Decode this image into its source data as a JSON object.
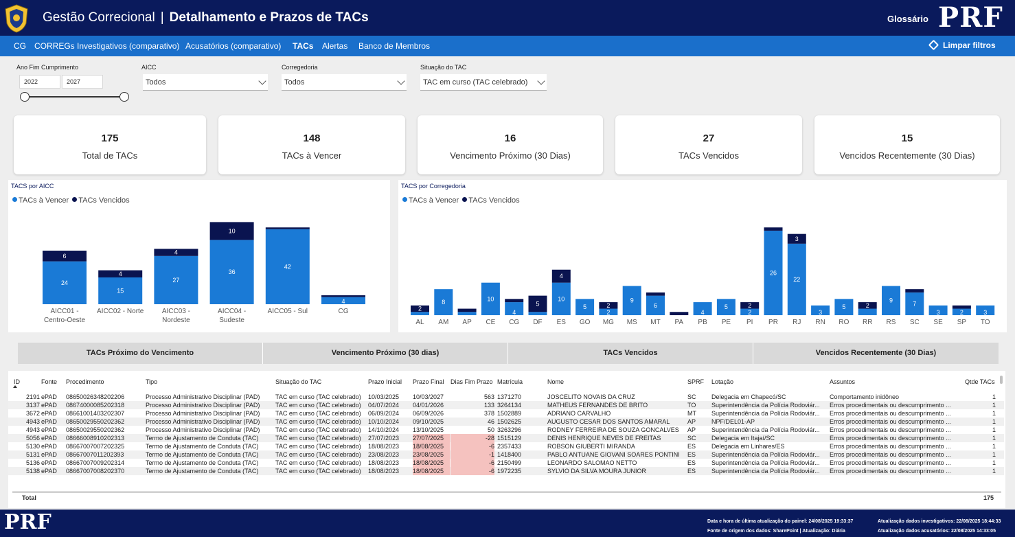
{
  "header": {
    "app_title": "Gestão Correcional",
    "separator": "|",
    "page_title": "Detalhamento e Prazos de TACs",
    "glossary_label": "Glossário",
    "logo_text": "PRF"
  },
  "nav": {
    "items": [
      {
        "label": "CG"
      },
      {
        "label": "CORREGs"
      },
      {
        "label": "Investigativos (comparativo)"
      },
      {
        "label": "Acusatórios (comparativo)"
      },
      {
        "label": "TACs"
      },
      {
        "label": "Alertas"
      },
      {
        "label": "Banco de Membros"
      }
    ],
    "active_item": "TACs",
    "clear_filters": "Limpar filtros"
  },
  "filters": {
    "year": {
      "label": "Ano Fim Cumprimento",
      "from": "2022",
      "to": "2027"
    },
    "aicc": {
      "label": "AICC",
      "value": "Todos"
    },
    "corregedoria": {
      "label": "Corregedoria",
      "value": "Todos"
    },
    "situacao": {
      "label": "Situação do TAC",
      "value": "TAC em curso (TAC celebrado)"
    }
  },
  "kpis": [
    {
      "value": "175",
      "label": "Total de TACs"
    },
    {
      "value": "148",
      "label": "TACs à Vencer"
    },
    {
      "value": "16",
      "label": "Vencimento Próximo (30 Dias)"
    },
    {
      "value": "27",
      "label": "TACs Vencidos"
    },
    {
      "value": "15",
      "label": "Vencidos Recentemente (30 Dias)"
    }
  ],
  "colors": {
    "a_vencer": "#1a7ad6",
    "vencidos": "#0a1450",
    "header": "#0a1a5c",
    "nav": "#1a6fcb",
    "overdue_cell": "#f5c2bf"
  },
  "chart_data": [
    {
      "type": "bar",
      "stacked": true,
      "title": "TACS por AICC",
      "legend": [
        "TACs à Vencer",
        "TACs Vencidos"
      ],
      "legend_position": "top-left",
      "categories": [
        "AICC01 - Centro-Oeste",
        "AICC02 - Norte",
        "AICC03 - Nordeste",
        "AICC04 - Sudeste",
        "AICC05 - Sul",
        "CG"
      ],
      "category_lines": [
        [
          "AICC01 -",
          "Centro-Oeste"
        ],
        [
          "AICC02 - Norte"
        ],
        [
          "AICC03 -",
          "Nordeste"
        ],
        [
          "AICC04 -",
          "Sudeste"
        ],
        [
          "AICC05 - Sul"
        ],
        [
          "CG"
        ]
      ],
      "series": [
        {
          "name": "TACs à Vencer",
          "values": [
            24,
            15,
            27,
            36,
            42,
            4
          ]
        },
        {
          "name": "TACs Vencidos",
          "values": [
            6,
            4,
            4,
            10,
            1,
            1
          ]
        }
      ],
      "labels_a_vencer": [
        "24",
        "15",
        "27",
        "36",
        "42",
        "4"
      ],
      "labels_vencidos": [
        "6",
        "4",
        "4",
        "10",
        "",
        ""
      ],
      "ylim": [
        0,
        55
      ]
    },
    {
      "type": "bar",
      "stacked": true,
      "title": "TACS por Corregedoria",
      "legend": [
        "TACs à Vencer",
        "TACs Vencidos"
      ],
      "legend_position": "top-left",
      "categories": [
        "AL",
        "AM",
        "AP",
        "CE",
        "CG",
        "DF",
        "ES",
        "GO",
        "MG",
        "MS",
        "MT",
        "PA",
        "PB",
        "PE",
        "PI",
        "PR",
        "RJ",
        "RN",
        "RO",
        "RR",
        "RS",
        "SC",
        "SE",
        "SP",
        "TO"
      ],
      "series": [
        {
          "name": "TACs à Vencer",
          "values": [
            1,
            8,
            1,
            10,
            4,
            1,
            10,
            5,
            2,
            9,
            6,
            0,
            4,
            5,
            2,
            26,
            22,
            3,
            5,
            2,
            9,
            7,
            3,
            2,
            3
          ]
        },
        {
          "name": "TACs Vencidos",
          "values": [
            2,
            0,
            1,
            0,
            1,
            5,
            4,
            0,
            2,
            0,
            1,
            1,
            0,
            0,
            2,
            1,
            3,
            0,
            0,
            2,
            0,
            1,
            0,
            1,
            0
          ]
        }
      ],
      "labels_a_vencer": [
        "",
        "8",
        "",
        "10",
        "4",
        "",
        "10",
        "5",
        "2",
        "9",
        "6",
        "",
        "4",
        "5",
        "2",
        "26",
        "22",
        "3",
        "5",
        "",
        "9",
        "7",
        "3",
        "2",
        "3"
      ],
      "labels_vencidos": [
        "2",
        "",
        "",
        "",
        "",
        "5",
        "4",
        "",
        "2",
        "",
        "",
        "",
        "",
        "",
        "2",
        "",
        "3",
        "",
        "",
        "2",
        "",
        "",
        "",
        "",
        ""
      ],
      "ylim": [
        0,
        30
      ]
    }
  ],
  "table_buttons": [
    "TACs Próximo do Vencimento",
    "Vencimento Próximo (30 dias)",
    "TACs Vencidos",
    "Vencidos Recentemente (30 Dias)"
  ],
  "table": {
    "columns": [
      "ID",
      "Fonte",
      "Procedimento",
      "Tipo",
      "Situação do TAC",
      "Prazo Inicial",
      "Prazo Final",
      "Dias Fim Prazo",
      "Matrícula",
      "Nome",
      "SPRF",
      "Lotação",
      "Assuntos",
      "Qtde TACs"
    ],
    "rows": [
      [
        "2191",
        "ePAD",
        "08650026348202206",
        "Processo Administrativo Disciplinar (PAD)",
        "TAC em curso (TAC celebrado)",
        "10/03/2025",
        "10/03/2027",
        "563",
        "1371270",
        "JOSCELITO NOVAIS DA CRUZ",
        "SC",
        "Delegacia em Chapecó/SC",
        "Comportamento inidôneo",
        "1"
      ],
      [
        "3137",
        "ePAD",
        "08674000085202318",
        "Processo Administrativo Disciplinar (PAD)",
        "TAC em curso (TAC celebrado)",
        "04/07/2024",
        "04/01/2026",
        "133",
        "3264134",
        "MATHEUS FERNANDES DE BRITO",
        "TO",
        "Superintendência da Polícia Rodoviár...",
        "Erros procedimentais ou descumprimento ...",
        "1"
      ],
      [
        "3672",
        "ePAD",
        "08661001403202307",
        "Processo Administrativo Disciplinar (PAD)",
        "TAC em curso (TAC celebrado)",
        "06/09/2024",
        "06/09/2026",
        "378",
        "1502889",
        "ADRIANO CARVALHO",
        "MT",
        "Superintendência da Polícia Rodoviár...",
        "Erros procedimentais ou descumprimento ...",
        "1"
      ],
      [
        "4943",
        "ePAD",
        "08650029550202362",
        "Processo Administrativo Disciplinar (PAD)",
        "TAC em curso (TAC celebrado)",
        "10/10/2024",
        "09/10/2025",
        "46",
        "1502625",
        "AUGUSTO CESAR DOS SANTOS AMARAL",
        "AP",
        "NPF/DEL01-AP",
        "Erros procedimentais ou descumprimento ...",
        "1"
      ],
      [
        "4943",
        "ePAD",
        "08650029550202362",
        "Processo Administrativo Disciplinar (PAD)",
        "TAC em curso (TAC celebrado)",
        "14/10/2024",
        "13/10/2025",
        "50",
        "3263296",
        "RODNEY FERREIRA DE SOUZA GONCALVES",
        "AP",
        "Superintendência da Polícia Rodoviár...",
        "Erros procedimentais ou descumprimento ...",
        "1"
      ],
      [
        "5056",
        "ePAD",
        "08666008910202313",
        "Termo de Ajustamento de Conduta (TAC)",
        "TAC em curso (TAC celebrado)",
        "27/07/2023",
        "27/07/2025",
        "-28",
        "1515129",
        "DENIS HENRIQUE NEVES DE FREITAS",
        "SC",
        "Delegacia em Itajaí/SC",
        "Erros procedimentais ou descumprimento ...",
        "1"
      ],
      [
        "5130",
        "ePAD",
        "08667007007202325",
        "Termo de Ajustamento de Conduta (TAC)",
        "TAC em curso (TAC celebrado)",
        "18/08/2023",
        "18/08/2025",
        "-6",
        "2357433",
        "ROBSON GIUBERTI MIRANDA",
        "ES",
        "Delegacia em Linhares/ES",
        "Erros procedimentais ou descumprimento ...",
        "1"
      ],
      [
        "5131",
        "ePAD",
        "08667007011202393",
        "Termo de Ajustamento de Conduta (TAC)",
        "TAC em curso (TAC celebrado)",
        "23/08/2023",
        "23/08/2025",
        "-1",
        "1418400",
        "PABLO ANTUANE GIOVANI SOARES PONTINI",
        "ES",
        "Superintendência da Polícia Rodoviár...",
        "Erros procedimentais ou descumprimento ...",
        "1"
      ],
      [
        "5136",
        "ePAD",
        "08667007009202314",
        "Termo de Ajustamento de Conduta (TAC)",
        "TAC em curso (TAC celebrado)",
        "18/08/2023",
        "18/08/2025",
        "-6",
        "2150499",
        "LEONARDO SALOMAO NETTO",
        "ES",
        "Superintendência da Polícia Rodoviár...",
        "Erros procedimentais ou descumprimento ...",
        "1"
      ],
      [
        "5138",
        "ePAD",
        "08667007008202370",
        "Termo de Ajustamento de Conduta (TAC)",
        "TAC em curso (TAC celebrado)",
        "18/08/2023",
        "18/08/2025",
        "-6",
        "1972235",
        "SYLVIO DA SILVA MOURA JUNIOR",
        "ES",
        "Superintendência da Polícia Rodoviár...",
        "Erros procedimentais ou descumprimento ...",
        "1"
      ]
    ],
    "total_label": "Total",
    "total_value": "175"
  },
  "footer": {
    "logo_text": "PRF",
    "update_panel": "Data e hora de última atualização do painel: 24/08/2025 19:33:37",
    "source": "Fonte de origem dos dados: SharePoint | Atualização: Diária",
    "update_investigativos": "Atualização dados investigativos: 22/08/2025 18:44:33",
    "update_acusatorios": "Atualização dados acusatórios: 22/08/2025 14:33:05"
  }
}
